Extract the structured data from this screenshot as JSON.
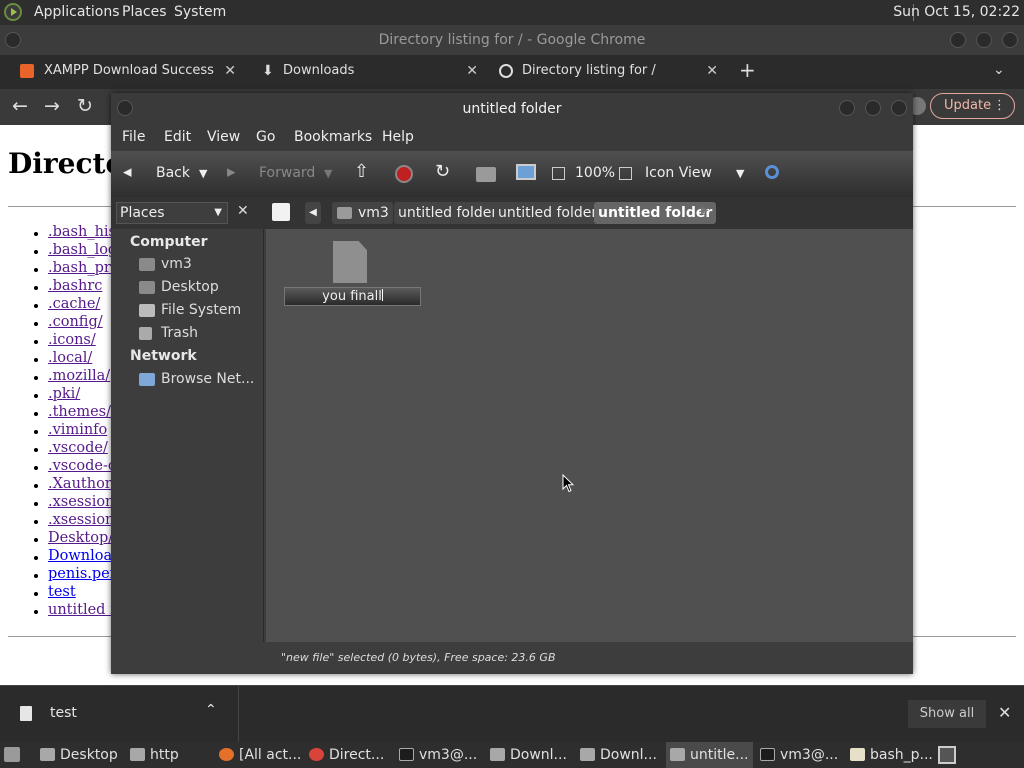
{
  "top_panel": {
    "menus": [
      "Applications",
      "Places",
      "System"
    ],
    "clock": "Sun Oct 15, 02:22"
  },
  "chrome": {
    "window_title": "Directory listing for / - Google Chrome",
    "tabs": [
      {
        "label": "XAMPP Download Success",
        "icon": "xampp-icon"
      },
      {
        "label": "Downloads",
        "icon": "download-icon"
      },
      {
        "label": "Directory listing for /",
        "icon": "globe-icon"
      }
    ],
    "new_tab": "+",
    "update_label": "Update"
  },
  "page": {
    "heading": "Directory listing for /",
    "entries": [
      ".bash_history",
      ".bash_logout",
      ".bash_profile",
      ".bashrc",
      ".cache/",
      ".config/",
      ".icons/",
      ".local/",
      ".mozilla/",
      ".pki/",
      ".themes/",
      ".viminfo",
      ".vscode/",
      ".vscode-cli/",
      ".Xauthority",
      ".xsession-errors",
      ".xsession-errors.old",
      "Desktop/",
      "Downloads/",
      "penis.pem",
      "test",
      "untitled folder/"
    ]
  },
  "downloads_bar": {
    "item": "test",
    "show_all": "Show all"
  },
  "taskbar": {
    "items": [
      "Desktop",
      "http",
      "[All act...",
      "Direct...",
      "vm3@...",
      "Downl...",
      "Downl...",
      "untitle...",
      "vm3@...",
      "bash_p..."
    ]
  },
  "nautilus": {
    "title": "untitled folder",
    "menu": [
      "File",
      "Edit",
      "View",
      "Go",
      "Bookmarks",
      "Help"
    ],
    "toolbar": {
      "back": "Back",
      "forward": "Forward",
      "zoom": "100%",
      "view_mode": "Icon View"
    },
    "places_label": "Places",
    "breadcrumbs": [
      "vm3",
      "untitled folder",
      "untitled folder",
      "untitled folder"
    ],
    "sidebar": {
      "computer_header": "Computer",
      "computer_items": [
        "vm3",
        "Desktop",
        "File System",
        "Trash"
      ],
      "network_header": "Network",
      "network_items": [
        "Browse Net..."
      ]
    },
    "file": {
      "rename_value": "you finall"
    },
    "status": "\"new file\" selected (0 bytes), Free space: 23.6 GB"
  }
}
